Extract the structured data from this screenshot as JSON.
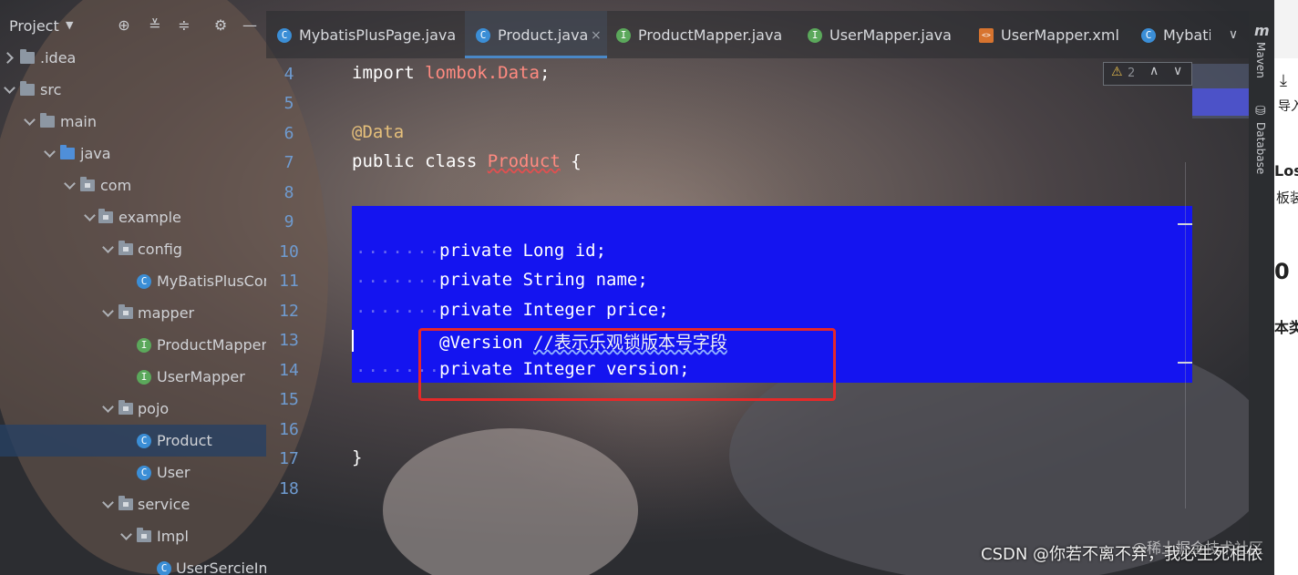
{
  "project_panel": {
    "title": "Project",
    "tree": [
      {
        "label": ".idea",
        "kind": "folder"
      },
      {
        "label": "src",
        "kind": "folder"
      },
      {
        "label": "main",
        "kind": "folder"
      },
      {
        "label": "java",
        "kind": "folder-blue"
      },
      {
        "label": "com",
        "kind": "package"
      },
      {
        "label": "example",
        "kind": "package"
      },
      {
        "label": "config",
        "kind": "package"
      },
      {
        "label": "MyBatisPlusConf",
        "kind": "class"
      },
      {
        "label": "mapper",
        "kind": "package"
      },
      {
        "label": "ProductMapper",
        "kind": "interface"
      },
      {
        "label": "UserMapper",
        "kind": "interface"
      },
      {
        "label": "pojo",
        "kind": "package"
      },
      {
        "label": "Product",
        "kind": "class",
        "selected": true
      },
      {
        "label": "User",
        "kind": "class"
      },
      {
        "label": "service",
        "kind": "package"
      },
      {
        "label": "Impl",
        "kind": "package"
      },
      {
        "label": "UserSercieImp",
        "kind": "class"
      }
    ]
  },
  "tabs": [
    {
      "label": "MybatisPlusPage.java",
      "icon": "C"
    },
    {
      "label": "Product.java",
      "icon": "C",
      "active": true
    },
    {
      "label": "ProductMapper.java",
      "icon": "I"
    },
    {
      "label": "UserMapper.java",
      "icon": "I"
    },
    {
      "label": "UserMapper.xml",
      "icon": "xml"
    },
    {
      "label": "Mybatis",
      "icon": "C"
    }
  ],
  "right_strip": {
    "maven": "Maven",
    "database": "Database"
  },
  "inspection": {
    "warnings": "2"
  },
  "gutter": [
    "4",
    "5",
    "6",
    "7",
    "8",
    "9",
    "10",
    "11",
    "12",
    "13",
    "14",
    "15",
    "16",
    "17",
    "18"
  ],
  "code": {
    "l4_kw": "import",
    "l4_pkg": "lombok.Data",
    "l4_end": ";",
    "l6": "@Data",
    "l7_kw": "public class",
    "l7_cls": "Product",
    "l7_end": "{",
    "l10": "private Long id;",
    "l11": "private String name;",
    "l12": "private Integer price;",
    "l13_anno": "@Version",
    "l13_cmt": "//表示乐观锁版本号字段",
    "l14": "private Integer version;",
    "l17": "}"
  },
  "edge_text": {
    "t1": "导入",
    "t2": "Los",
    "t3": "板装",
    "t4": "0",
    "t5": "本类"
  },
  "watermark": "CSDN @你若不离不弃，我必生死相依",
  "watermark_faint": "@稀土掘金技术社区",
  "colors": {
    "selection": "#1414f0",
    "highlight_box": "#e52929"
  }
}
